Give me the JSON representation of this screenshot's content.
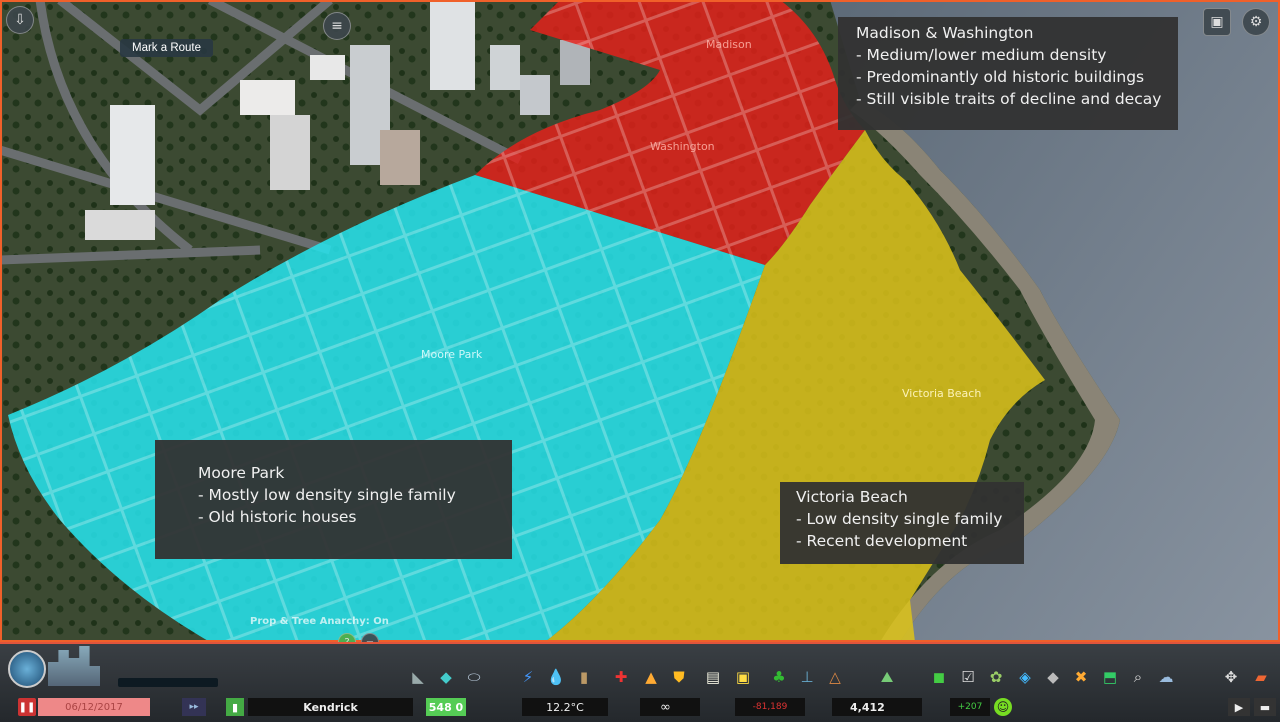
{
  "map": {
    "tooltip": "Mark a Route",
    "district_labels": {
      "madison": "Madison",
      "washington": "Washington",
      "moore_park": "Moore Park",
      "victoria_beach": "Victoria Beach"
    },
    "anarchy_status": "Prop & Tree Anarchy: On",
    "colors": {
      "red_district": "#e8201a",
      "cyan_district": "#27e4ee",
      "yellow_district": "#dcc21a",
      "water": "#6f7d8c"
    }
  },
  "annotations": {
    "madison_washington": {
      "title": "Madison & Washington",
      "lines": [
        "- Medium/lower medium density",
        "- Predominantly old historic buildings",
        "- Still visible traits of decline and decay"
      ]
    },
    "moore_park": {
      "title": "Moore Park",
      "lines": [
        "- Mostly low density single family",
        "- Old historic houses"
      ]
    },
    "victoria_beach": {
      "title": "Victoria Beach",
      "lines": [
        "- Low density single family",
        "- Recent development"
      ]
    }
  },
  "status_bar": {
    "date": "06/12/2017",
    "city_name": "Kendrick",
    "demand_value": "548 0",
    "temperature": "12.2°C",
    "budget": "∞",
    "income": "-81,189",
    "population": "4,412",
    "population_change": "+207"
  },
  "toolbar": {
    "icons": [
      "roads-icon",
      "zoning-icon",
      "districts-icon",
      "electricity-icon",
      "water-icon",
      "garbage-icon",
      "healthcare-icon",
      "fire-icon",
      "police-icon",
      "education-icon",
      "public-transport-icon",
      "decoration-icon",
      "monuments-icon",
      "wonders-icon",
      "landscaping-icon",
      "policies-icon",
      "info-views-icon",
      "areas-icon",
      "move-it-icon",
      "search-icon",
      "clouds-icon",
      "bulldozer-icon",
      "economy-icon"
    ]
  }
}
